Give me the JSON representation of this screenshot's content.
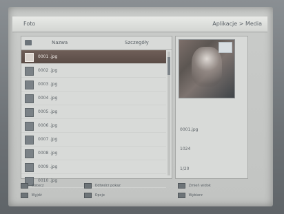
{
  "window": {
    "title": "Foto",
    "path": "Aplikacje > Media"
  },
  "list": {
    "header_name": "Nazwa",
    "header_info": "Szczegóły",
    "items": [
      {
        "name": "0001 .jpg",
        "meta": "",
        "selected": true
      },
      {
        "name": "0002 .jpg",
        "meta": "",
        "selected": false
      },
      {
        "name": "0003 .jpg",
        "meta": "",
        "selected": false
      },
      {
        "name": "0004 .jpg",
        "meta": "",
        "selected": false
      },
      {
        "name": "0005 .jpg",
        "meta": "",
        "selected": false
      },
      {
        "name": "0006 .jpg",
        "meta": "",
        "selected": false
      },
      {
        "name": "0007 .jpg",
        "meta": "",
        "selected": false
      },
      {
        "name": "0008 .jpg",
        "meta": "",
        "selected": false
      },
      {
        "name": "0009 .jpg",
        "meta": "",
        "selected": false
      },
      {
        "name": "0010 .jpg",
        "meta": "",
        "selected": false
      },
      {
        "name": "0011 .jpg",
        "meta": "",
        "selected": false
      }
    ]
  },
  "info": {
    "line1": "0001.jpg",
    "line2": "1024",
    "line3": "1/20",
    "bottom_right": ""
  },
  "legend": {
    "item1": "Wstecz",
    "item2": "Odtwórz pokaz",
    "item3": "Zmień widok",
    "item4": "Wyjdź",
    "item5": "Opcje",
    "item6": "Wybierz"
  }
}
